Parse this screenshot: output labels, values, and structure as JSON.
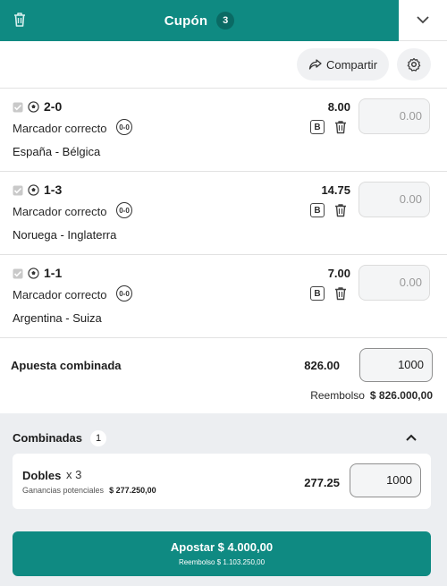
{
  "header": {
    "title": "Cupón",
    "count": "3"
  },
  "toolbar": {
    "share_label": "Compartir"
  },
  "bets": [
    {
      "score": "2-0",
      "market": "Marcador correcto",
      "market_badge": "0-0",
      "event": "España - Bélgica",
      "odds": "8.00",
      "boost_label": "B",
      "stake_placeholder": "0.00"
    },
    {
      "score": "1-3",
      "market": "Marcador correcto",
      "market_badge": "0-0",
      "event": "Noruega - Inglaterra",
      "odds": "14.75",
      "boost_label": "B",
      "stake_placeholder": "0.00"
    },
    {
      "score": "1-1",
      "market": "Marcador correcto",
      "market_badge": "0-0",
      "event": "Argentina - Suiza",
      "odds": "7.00",
      "boost_label": "B",
      "stake_placeholder": "0.00"
    }
  ],
  "combined": {
    "label": "Apuesta combinada",
    "odds": "826.00",
    "stake": "1000",
    "refund_label": "Reembolso",
    "refund_value": "$ 826.000,00"
  },
  "system": {
    "title": "Combinadas",
    "count": "1",
    "card": {
      "name": "Dobles",
      "multiplier": "x 3",
      "potential_label": "Ganancias potenciales",
      "potential_value": "$ 277.250,00",
      "odds": "277.25",
      "stake": "1000"
    }
  },
  "footer": {
    "place_label": "Apostar $ 4.000,00",
    "refund_text": "Reembolso $ 1.103.250,00"
  },
  "colors": {
    "brand": "#0f8a82",
    "brand_dark": "#0a6a64",
    "panel": "#eceef1"
  },
  "icons": [
    "trash-icon",
    "chevron-down-icon",
    "share-icon",
    "settings-icon",
    "checkbox-icon",
    "soccer-ball-icon",
    "boost-icon",
    "chevron-up-icon"
  ]
}
